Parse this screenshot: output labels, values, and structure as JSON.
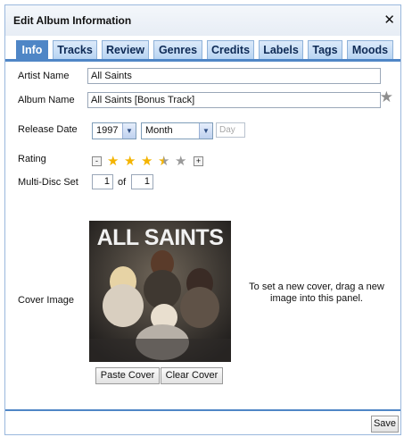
{
  "dialog": {
    "title": "Edit Album Information",
    "close_glyph": "✕"
  },
  "tabs": [
    {
      "label": "Info",
      "active": true
    },
    {
      "label": "Tracks"
    },
    {
      "label": "Review"
    },
    {
      "label": "Genres"
    },
    {
      "label": "Credits"
    },
    {
      "label": "Labels"
    },
    {
      "label": "Tags"
    },
    {
      "label": "Moods"
    }
  ],
  "fields": {
    "artist_label": "Artist Name",
    "artist_value": "All Saints",
    "album_label": "Album Name",
    "album_value": "All Saints [Bonus Track]",
    "release_label": "Release Date",
    "release_year": "1997",
    "release_month": "Month",
    "release_day_placeholder": "Day",
    "rating_label": "Rating",
    "rating_value": 3.5,
    "rating_max": 5,
    "rating_minus": "-",
    "rating_plus": "+",
    "multidisc_label": "Multi-Disc Set",
    "disc_number": "1",
    "disc_of": "of",
    "disc_total": "1",
    "cover_label": "Cover Image"
  },
  "cover": {
    "title_text": "ALL SAINTS",
    "hint": "To set a new cover, drag a new image into this panel.",
    "paste_label": "Paste Cover",
    "clear_label": "Clear Cover"
  },
  "footer": {
    "save_label": "Save"
  },
  "colors": {
    "accent": "#4f86c6",
    "star_full": "#f4b400",
    "star_empty": "#9a9a9a"
  }
}
